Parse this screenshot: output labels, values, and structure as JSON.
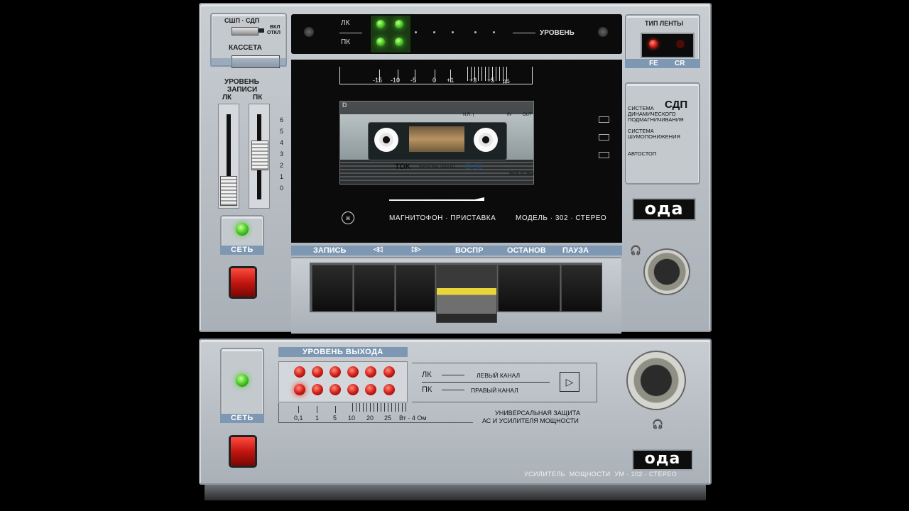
{
  "deck": {
    "sdp_label": "СШП · СДП",
    "vkl_label": "ВКЛ",
    "otkl_label": "ОТКЛ",
    "cassette_label": "КАССЕТА",
    "rec_level_label_1": "УРОВЕНЬ",
    "rec_level_label_2": "ЗАПИСИ",
    "left_ch": "ЛК",
    "right_ch": "ПК",
    "slider_scale": [
      "6",
      "5",
      "4",
      "3",
      "2",
      "1",
      "0"
    ],
    "power_label": "СЕТЬ",
    "vu": {
      "left_label": "ЛК",
      "right_label": "ПК",
      "level_label": "УРОВЕНЬ",
      "scale": [
        "-15",
        "-10",
        "-5",
        "0",
        "+1",
        "+3",
        "+5",
        "дБ"
      ]
    },
    "tape_type_label": "ТИП ЛЕНТЫ",
    "tape_fe": "FE",
    "tape_cr": "CR",
    "systems": {
      "sdp_big": "СДП",
      "line1": "СИСТЕМА",
      "line2": "ДИНАМИЧЕСКОГО",
      "line3": "ПОДМАГНИЧИВАНИЯ",
      "nr_line1": "СИСТЕМА",
      "nr_line2": "ШУМОПОНИЖЕНИЯ",
      "autostop": "АВТОСТОП"
    },
    "brand": "ода",
    "description": "МАГНИТОФОН · ПРИСТАВКА",
    "model": "МОДЕЛЬ · 302 · СТЕРЕО",
    "cassette": {
      "brand": "TDK",
      "type": "Normal Bias 120μs EQ",
      "model": "D 90",
      "side": "D",
      "nr": "N.R. (",
      "in": "IN",
      "out": "OUT",
      "made": "MADE IN JAPAN"
    },
    "transport": {
      "record": "ЗАПИСЬ",
      "rewind": "◁◁",
      "ffwd": "▷▷",
      "play": "ВОСПР",
      "stop": "ОСТАНОВ",
      "pause": "ПАУЗА"
    }
  },
  "amp": {
    "power_label": "СЕТЬ",
    "output_level_label": "УРОВЕНЬ ВЫХОДА",
    "scale": [
      "0,1",
      "1",
      "5",
      "10",
      "20",
      "25",
      "Вт · 4 Ом"
    ],
    "left_short": "ЛК",
    "left_long": "ЛЕВЫЙ КАНАЛ",
    "right_short": "ПК",
    "right_long": "ПРАВЫЙ КАНАЛ",
    "protection_1": "УНИВЕРСАЛЬНАЯ ЗАЩИТА",
    "protection_2": "АС И УСИЛИТЕЛЯ МОЩНОСТИ",
    "brand": "ода",
    "model": "УСИЛИТЕЛЬ  МОЩНОСТИ  УМ · 102 · СТЕРЕО"
  },
  "colors": {
    "strip_blue": "#7e98b3",
    "led_green": "#52d12b",
    "led_red": "#d4201a"
  }
}
